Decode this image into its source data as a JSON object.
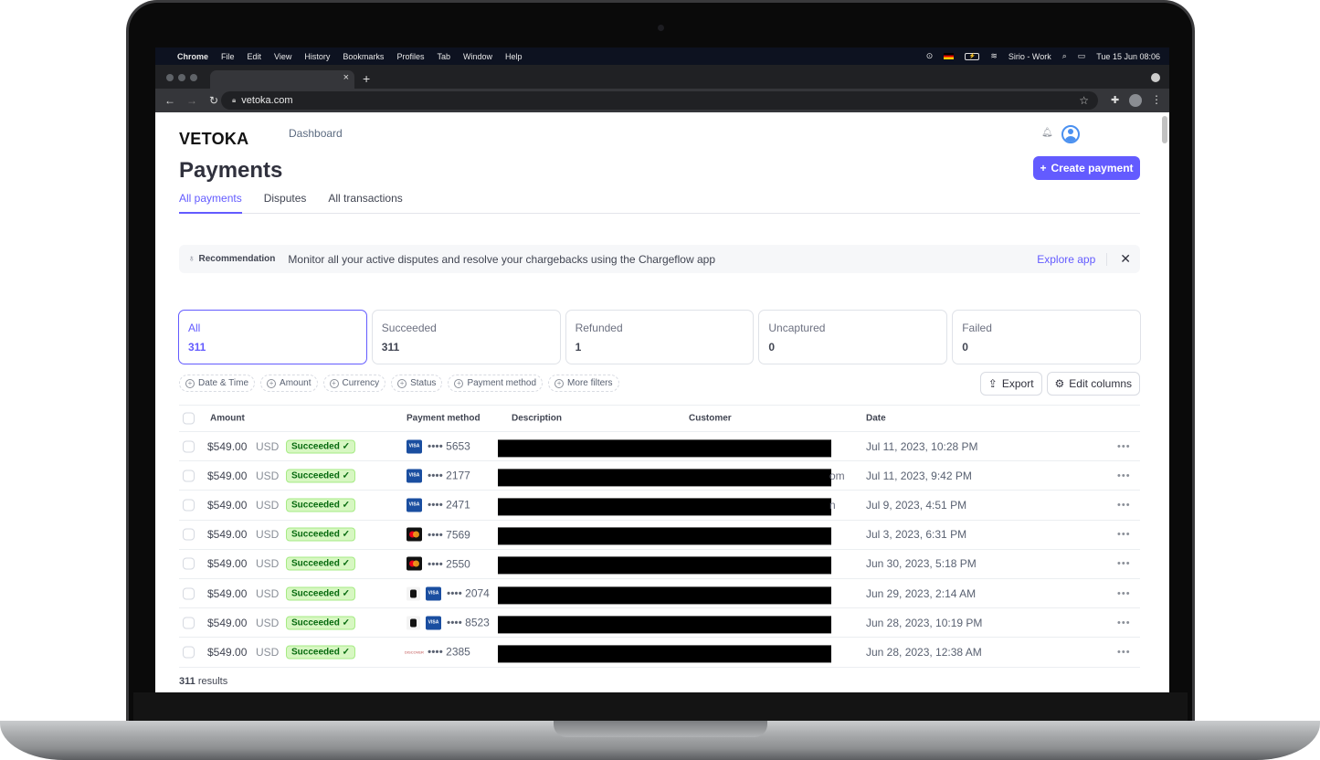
{
  "os_menubar": {
    "app_name": "Chrome",
    "menus": [
      "File",
      "Edit",
      "View",
      "History",
      "Bookmarks",
      "Profiles",
      "Tab",
      "Window",
      "Help"
    ],
    "user": "Sirio - Work",
    "clock": "Tue 15 Jun  08:06"
  },
  "browser": {
    "url": "vetoka.com",
    "tab_close": "×",
    "new_tab": "+"
  },
  "header": {
    "logo": "VETOKA",
    "nav_link": "Dashboard"
  },
  "page": {
    "title": "Payments",
    "create_button": "Create payment",
    "tabs": [
      {
        "label": "All payments",
        "active": true
      },
      {
        "label": "Disputes",
        "active": false
      },
      {
        "label": "All transactions",
        "active": false
      }
    ]
  },
  "recommendation": {
    "label": "Recommendation",
    "message": "Monitor all your active disputes and resolve your chargebacks using the Chargeflow app",
    "action": "Explore app",
    "close": "✕"
  },
  "status_cards": [
    {
      "label": "All",
      "count": "311",
      "active": true
    },
    {
      "label": "Succeeded",
      "count": "311",
      "active": false
    },
    {
      "label": "Refunded",
      "count": "1",
      "active": false
    },
    {
      "label": "Uncaptured",
      "count": "0",
      "active": false
    },
    {
      "label": "Failed",
      "count": "0",
      "active": false
    }
  ],
  "filters": [
    "Date & Time",
    "Amount",
    "Currency",
    "Status",
    "Payment method",
    "More filters"
  ],
  "actions": {
    "export": "Export",
    "edit_columns": "Edit columns"
  },
  "table": {
    "columns": {
      "amount": "Amount",
      "payment_method": "Payment method",
      "description": "Description",
      "customer": "Customer",
      "date": "Date"
    },
    "rows": [
      {
        "amount": "$549.00",
        "currency": "USD",
        "status": "Succeeded ✓",
        "brand": "visa",
        "wallet": "",
        "last4": "•••• 5653",
        "tail": "",
        "date": "Jul 11, 2023, 10:28 PM"
      },
      {
        "amount": "$549.00",
        "currency": "USD",
        "status": "Succeeded ✓",
        "brand": "visa",
        "wallet": "",
        "last4": "•••• 2177",
        "tail": "om",
        "date": "Jul 11, 2023, 9:42 PM"
      },
      {
        "amount": "$549.00",
        "currency": "USD",
        "status": "Succeeded ✓",
        "brand": "visa",
        "wallet": "",
        "last4": "•••• 2471",
        "tail": "n",
        "date": "Jul 9, 2023, 4:51 PM"
      },
      {
        "amount": "$549.00",
        "currency": "USD",
        "status": "Succeeded ✓",
        "brand": "mastercard",
        "wallet": "",
        "last4": "•••• 7569",
        "tail": "",
        "date": "Jul 3, 2023, 6:31 PM"
      },
      {
        "amount": "$549.00",
        "currency": "USD",
        "status": "Succeeded ✓",
        "brand": "mastercard",
        "wallet": "",
        "last4": "•••• 2550",
        "tail": "",
        "date": "Jun 30, 2023, 5:18 PM"
      },
      {
        "amount": "$549.00",
        "currency": "USD",
        "status": "Succeeded ✓",
        "brand": "visa",
        "wallet": "apple-pay",
        "last4": "•••• 2074",
        "tail": "",
        "date": "Jun 29, 2023, 2:14 AM"
      },
      {
        "amount": "$549.00",
        "currency": "USD",
        "status": "Succeeded ✓",
        "brand": "visa",
        "wallet": "apple-pay",
        "last4": "•••• 8523",
        "tail": "",
        "date": "Jun 28, 2023, 10:19 PM"
      },
      {
        "amount": "$549.00",
        "currency": "USD",
        "status": "Succeeded ✓",
        "brand": "discover",
        "wallet": "",
        "last4": "•••• 2385",
        "tail": "",
        "date": "Jun 28, 2023, 12:38 AM"
      }
    ],
    "row_menu": "•••",
    "results_count": "311",
    "results_label": "results"
  },
  "brand_labels": {
    "visa": "VISA",
    "discover": "DISCOVER"
  },
  "colors": {
    "accent": "#635bff",
    "success_bg": "#d7f7c2",
    "success_text": "#05690d"
  }
}
